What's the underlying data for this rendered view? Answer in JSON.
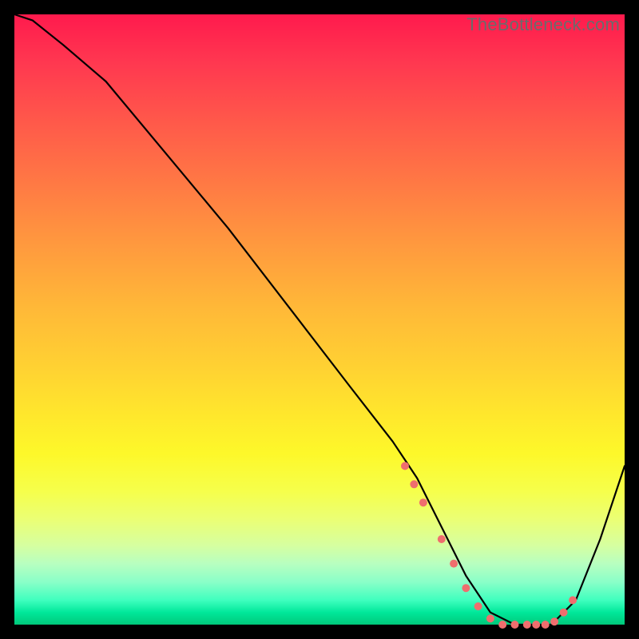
{
  "watermark": "TheBottleneck.com",
  "chart_data": {
    "type": "line",
    "title": "",
    "xlabel": "",
    "ylabel": "",
    "xlim": [
      0,
      100
    ],
    "ylim": [
      0,
      100
    ],
    "grid": false,
    "series": [
      {
        "name": "curve",
        "x": [
          0,
          3,
          8,
          15,
          25,
          35,
          45,
          55,
          62,
          66,
          70,
          74,
          78,
          82,
          85,
          88,
          92,
          96,
          100
        ],
        "values": [
          100,
          99,
          95,
          89,
          77,
          65,
          52,
          39,
          30,
          24,
          16,
          8,
          2,
          0,
          0,
          0,
          4,
          14,
          26
        ]
      }
    ],
    "markers": {
      "name": "highlight-dots",
      "x": [
        64,
        65.5,
        67,
        70,
        72,
        74,
        76,
        78,
        80,
        82,
        84,
        85.5,
        87,
        88.5,
        90,
        91.5
      ],
      "values": [
        26,
        23,
        20,
        14,
        10,
        6,
        3,
        1,
        0,
        0,
        0,
        0,
        0,
        0.5,
        2,
        4
      ]
    }
  }
}
